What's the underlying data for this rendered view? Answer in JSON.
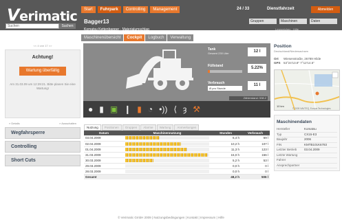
{
  "brand": {
    "logo_v": "V",
    "logo_rest": "erimatic"
  },
  "search": {
    "value": "Suchen",
    "button": "Suchen"
  },
  "nav": {
    "tabs": [
      "Start",
      "Fuhrpark",
      "Controlling",
      "Management"
    ],
    "active_tab": "Fuhrpark",
    "page_count": "24 / 33",
    "inbox_label": "Dienstfahrzeit",
    "login": "Abmelden"
  },
  "machine": {
    "title": "Bagger13",
    "subtitle": "Komatsu Kettenbagger · Materialumschlag",
    "selects": [
      "Gruppen",
      "Maschinen",
      "Daten"
    ],
    "links": "Lesezeichen · Hilfe"
  },
  "subtabs": {
    "items": [
      "Maschinenübersicht",
      "Cockpit",
      "Logbuch",
      "Verwaltung"
    ],
    "active": "Cockpit"
  },
  "sidebar": {
    "range_note": "<< 4 von 17 >>",
    "alert_title": "Achtung!",
    "alert_button": "Wartung überfällig",
    "alert_text": "Am 31.03.09 um 12:29:21. Bitte planen Sie eine Wartung!",
    "details": "» Details",
    "execute": "» Ausschalten",
    "menu": [
      "Wegfahrsperre",
      "Controlling",
      "Short Cuts"
    ]
  },
  "cockpit": {
    "tank": {
      "label": "Tank",
      "sub": "Gesamt 230 Liter",
      "value": "12 l",
      "level_percent": 5
    },
    "fill": {
      "label": "Füllstand",
      "value": "5.22%",
      "level_percent": 5.22
    },
    "consumption": {
      "label": "Verbrauch",
      "select": "Ø pro Stunde",
      "value": "11 l"
    },
    "counter": "Zählerstand: 538.2",
    "status_icons": [
      "light-icon",
      "door-icon",
      "battery-icon",
      "temperature-icon",
      "fuel-icon",
      "clock-icon",
      "signal-icon",
      "wrench-icon"
    ]
  },
  "usage": {
    "tabs": [
      "Nutzung",
      "Positionen",
      "Gruppen",
      "Alarme",
      "Wartung",
      "Anmerkungen"
    ],
    "active": "Nutzung",
    "columns": [
      "Datum",
      "Maschinennutzung",
      "Stunden",
      "Verbrauch"
    ],
    "rows": [
      {
        "date": "03.04.2009",
        "hours": "6,4 h",
        "consumption": "69 l",
        "usage_percent": 41
      },
      {
        "date": "02.04.2009",
        "hours": "10,2 h",
        "consumption": "107 l",
        "usage_percent": 66
      },
      {
        "date": "01.04.2009",
        "hours": "11,3 h",
        "consumption": "123 l",
        "usage_percent": 74
      },
      {
        "date": "31.03.2009",
        "hours": "15,0 h",
        "consumption": "156 l",
        "usage_percent": 98
      },
      {
        "date": "30.03.2009",
        "hours": "5,2 h",
        "consumption": "53 l",
        "usage_percent": 34
      },
      {
        "date": "29.03.2009",
        "hours": "0,0 h",
        "consumption": "0 l",
        "usage_percent": 0
      },
      {
        "date": "28.03.2009",
        "hours": "0,0 h",
        "consumption": "0 l",
        "usage_percent": 0
      }
    ],
    "total": {
      "label": "Gesamt",
      "hours": "48,2 h",
      "consumption": "506 l"
    }
  },
  "position": {
    "title": "Position",
    "subtitle": "Deutschland/Niedersachsen",
    "place_key": "Ort",
    "place": "Wiesenstraße, 26789 Hilde",
    "gps_key": "GPS",
    "gps": "53°24'13.8\" 7°12'14.5\"",
    "scale": "10 km",
    "copyright": "© 2009 NAVTEQ, Europa Technologies"
  },
  "machine_data": {
    "title": "Maschinendaten",
    "rows": [
      {
        "key": "Hersteller",
        "value": "Komatsu"
      },
      {
        "key": "Typ",
        "value": "CX15-E3"
      },
      {
        "key": "Baujahr",
        "value": "2006"
      },
      {
        "key": "FIN",
        "value": "KMTB101K6783"
      },
      {
        "key": "Letzter Betrieb",
        "value": "03.04.2009"
      },
      {
        "key": "Letzte Wartung",
        "value": ""
      },
      {
        "key": "Fahrer",
        "value": ""
      },
      {
        "key": "Ansprechpartner",
        "value": ""
      }
    ]
  },
  "footer": "© Verimatic GmbH 2009 | Nutzungsbedingungen | Kontakt | Impressum | Hilfe",
  "colors": {
    "accent": "#e8782d",
    "accent_dark": "#d45d11",
    "header": "#585858",
    "panel": "#8a8a8a"
  }
}
